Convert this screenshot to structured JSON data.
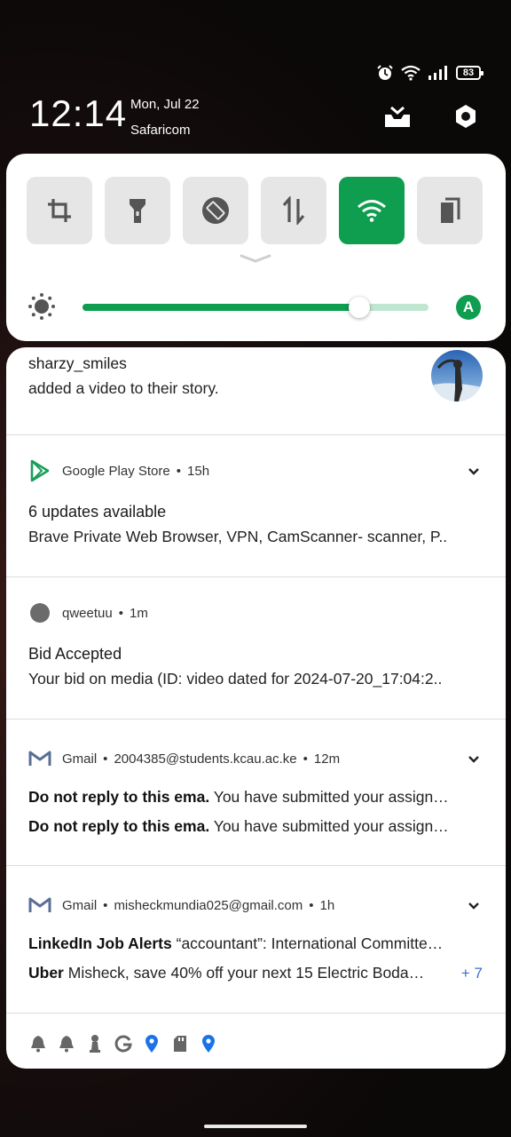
{
  "status_bar": {
    "battery": "83",
    "alarm_icon": "alarm-icon",
    "wifi_icon": "wifi-icon",
    "signal_icon": "signal-icon"
  },
  "header": {
    "time": "12:14",
    "date": "Mon, Jul 22",
    "carrier": "Safaricom",
    "clear_icon": "clear-all-icon",
    "settings_icon": "settings-icon"
  },
  "quick_settings": {
    "tiles": [
      {
        "icon": "screenshot-crop-icon",
        "active": false
      },
      {
        "icon": "flashlight-icon",
        "active": false
      },
      {
        "icon": "auto-rotate-icon",
        "active": false
      },
      {
        "icon": "mobile-data-icon",
        "active": false
      },
      {
        "icon": "wifi-icon",
        "active": true
      },
      {
        "icon": "reading-mode-icon",
        "active": false
      }
    ],
    "brightness_level": 0.8,
    "auto_brightness_label": "A",
    "accent_color": "#0f9d4f"
  },
  "notifications": {
    "story": {
      "title": "sharzy_smiles",
      "body": "added a video to their story."
    },
    "play_store": {
      "app": "Google Play Store",
      "time": "15h",
      "title": "6 updates available",
      "body": "Brave Private Web Browser, VPN, CamScanner- scanner, P.."
    },
    "qweetuu": {
      "app": "qweetuu",
      "time": "1m",
      "title": "Bid Accepted",
      "body": "Your bid on media (ID: video dated for 2024-07-20_17:04:2.."
    },
    "gmail_1": {
      "app": "Gmail",
      "account": "2004385@students.kcau.ac.ke",
      "time": "12m",
      "line1_sender": "Do not reply to this ema.",
      "line1_text": "You have submitted your assign…",
      "line2_sender": "Do not reply to this ema.",
      "line2_text": "You have submitted your assign…"
    },
    "gmail_2": {
      "app": "Gmail",
      "account": "misheckmundia025@gmail.com",
      "time": "1h",
      "line1_sender": "LinkedIn Job Alerts",
      "line1_text": "“accountant”: International Committe…",
      "line2_sender": "Uber",
      "line2_text": "Misheck, save 40% off your next 15 Electric Boda…",
      "more": "+ 7"
    }
  },
  "tray_icons": [
    "bell-icon",
    "bell-icon",
    "chess-pawn-icon",
    "google-icon",
    "location-pin-icon",
    "sd-card-icon",
    "location-pin-icon"
  ],
  "dot": "•"
}
